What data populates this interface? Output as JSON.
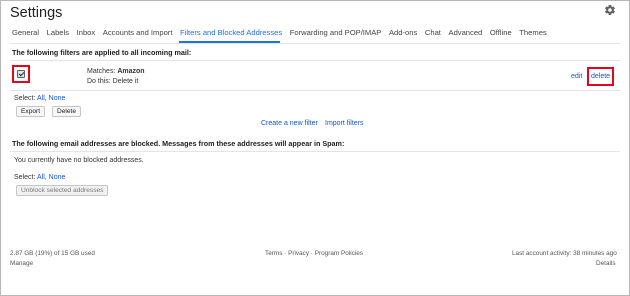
{
  "header": {
    "title": "Settings",
    "settings_icon": "gear-icon"
  },
  "tabs": [
    {
      "label": "General"
    },
    {
      "label": "Labels"
    },
    {
      "label": "Inbox"
    },
    {
      "label": "Accounts and Import"
    },
    {
      "label": "Filters and Blocked Addresses",
      "active": true
    },
    {
      "label": "Forwarding and POP/IMAP"
    },
    {
      "label": "Add-ons"
    },
    {
      "label": "Chat"
    },
    {
      "label": "Advanced"
    },
    {
      "label": "Offline"
    },
    {
      "label": "Themes"
    }
  ],
  "filters": {
    "heading": "The following filters are applied to all incoming mail:",
    "items": [
      {
        "matches_label": "Matches: ",
        "matches_value": "Amazon",
        "action": "Do this: Delete it",
        "checked": true,
        "edit_label": "edit",
        "delete_label": "delete"
      }
    ],
    "select_label": "Select:",
    "select_all": "All",
    "select_sep": ",",
    "select_none": "None",
    "export_label": "Export",
    "delete_label": "Delete",
    "create_link": "Create a new filter",
    "import_link": "Import filters"
  },
  "blocked": {
    "heading": "The following email addresses are blocked. Messages from these addresses will appear in Spam:",
    "empty_text": "You currently have no blocked addresses.",
    "select_label": "Select:",
    "select_all": "All",
    "select_sep": ",",
    "select_none": "None",
    "unblock_label": "Unblock selected addresses"
  },
  "footer": {
    "storage": "2.87 GB (19%) of 15 GB used",
    "manage": "Manage",
    "policies": "Terms · Privacy · Program Policies",
    "activity": "Last account activity: 38 minutes ago",
    "details": "Details"
  },
  "colors": {
    "accent": "#1a73e8",
    "link": "#1155cc",
    "highlight_box": "#e0081e"
  }
}
